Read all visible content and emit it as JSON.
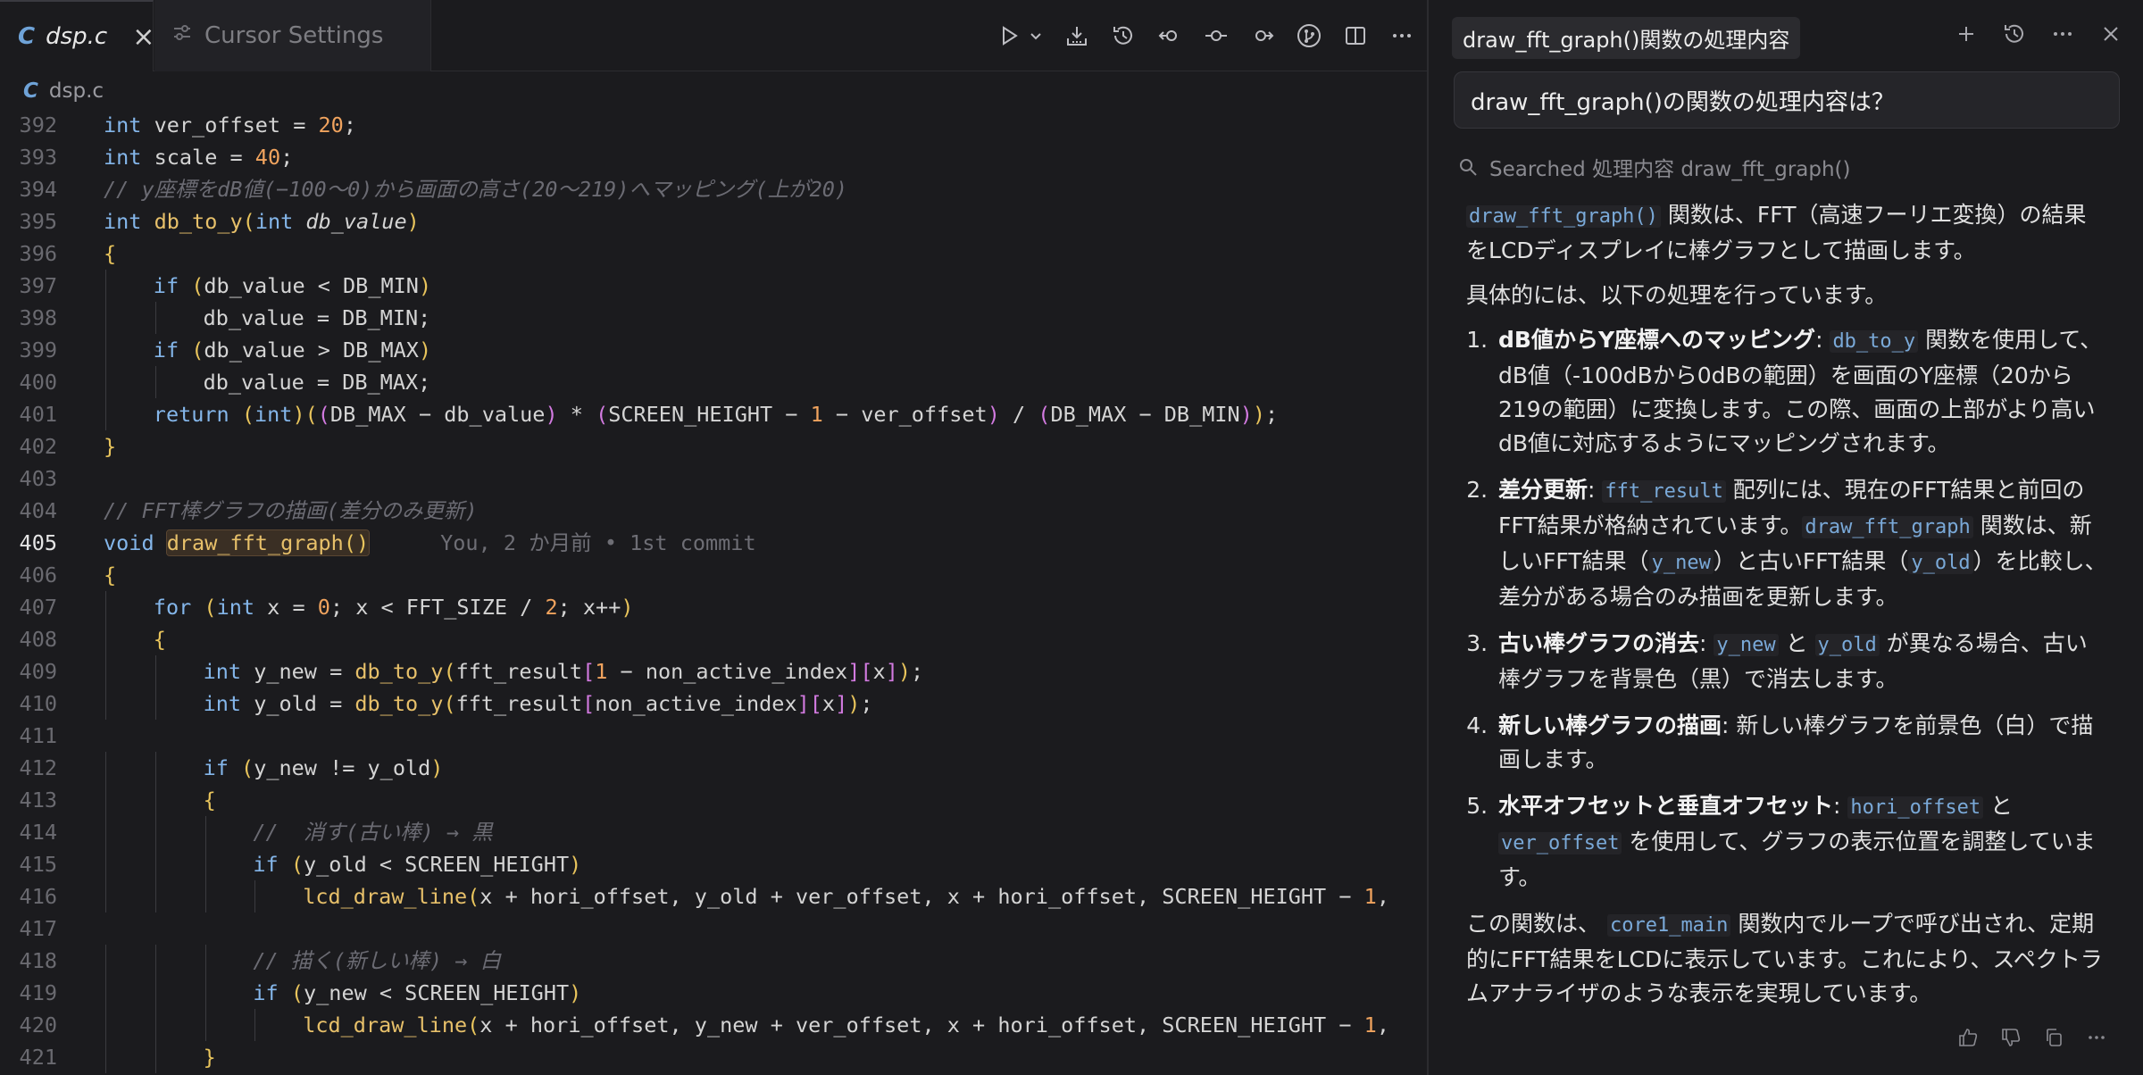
{
  "tabs": [
    {
      "icon": "c-file-icon",
      "glyph": "C",
      "label": "dsp.c",
      "active": true
    },
    {
      "icon": "settings-sliders-icon",
      "label": "Cursor Settings",
      "active": false
    }
  ],
  "breadcrumb": {
    "glyph": "C",
    "label": "dsp.c"
  },
  "toolbar": {
    "icons": [
      "run-icon",
      "chevron-down-icon",
      "download-icon",
      "history-icon",
      "go-back-icon",
      "commit-icon",
      "go-forward-icon",
      "git-graph-icon",
      "split-editor-icon",
      "more-icon"
    ]
  },
  "code": {
    "active_line": 405,
    "blame": "You, 2 か月前 • 1st commit",
    "lines": [
      {
        "n": "392",
        "text": "int ver_offset = 20;"
      },
      {
        "n": "393",
        "text": "int scale = 40;"
      },
      {
        "n": "394",
        "text": "// y座標をdB値(−100〜0)から画面の高さ(20〜219)へマッピング(上が20)"
      },
      {
        "n": "395",
        "text": "int db_to_y(int db_value)"
      },
      {
        "n": "396",
        "text": "{"
      },
      {
        "n": "397",
        "text": "if (db_value < DB_MIN)"
      },
      {
        "n": "398",
        "text": "db_value = DB_MIN;"
      },
      {
        "n": "399",
        "text": "if (db_value > DB_MAX)"
      },
      {
        "n": "400",
        "text": "db_value = DB_MAX;"
      },
      {
        "n": "401",
        "text": "return (int)((DB_MAX − db_value) * (SCREEN_HEIGHT − 1 − ver_offset) / (DB_MAX − DB_MIN));"
      },
      {
        "n": "402",
        "text": "}"
      },
      {
        "n": "403",
        "text": ""
      },
      {
        "n": "404",
        "text": "// FFT棒グラフの描画(差分のみ更新)"
      },
      {
        "n": "405",
        "text": "void draw_fft_graph()"
      },
      {
        "n": "406",
        "text": "{"
      },
      {
        "n": "407",
        "text": "for (int x = 0; x < FFT_SIZE / 2; x++)"
      },
      {
        "n": "408",
        "text": "{"
      },
      {
        "n": "409",
        "text": "int y_new = db_to_y(fft_result[1 − non_active_index][x]);"
      },
      {
        "n": "410",
        "text": "int y_old = db_to_y(fft_result[non_active_index][x]);"
      },
      {
        "n": "411",
        "text": ""
      },
      {
        "n": "412",
        "text": "if (y_new != y_old)"
      },
      {
        "n": "413",
        "text": "{"
      },
      {
        "n": "414",
        "text": "//  消す(古い棒) → 黒"
      },
      {
        "n": "415",
        "text": "if (y_old < SCREEN_HEIGHT)"
      },
      {
        "n": "416",
        "text": "lcd_draw_line(x + hori_offset, y_old + ver_offset, x + hori_offset, SCREEN_HEIGHT − 1,"
      },
      {
        "n": "417",
        "text": ""
      },
      {
        "n": "418",
        "text": "// 描く(新しい棒) → 白"
      },
      {
        "n": "419",
        "text": "if (y_new < SCREEN_HEIGHT)"
      },
      {
        "n": "420",
        "text": "lcd_draw_line(x + hori_offset, y_new + ver_offset, x + hori_offset, SCREEN_HEIGHT − 1,"
      },
      {
        "n": "421",
        "text": "}"
      }
    ]
  },
  "chat": {
    "title": "draw_fft_graph()関数の処理内容",
    "actions": [
      "plus-icon",
      "history-icon",
      "more-icon",
      "close-icon"
    ],
    "user_message": "draw_fft_graph()の関数の処理内容は？",
    "search_status": "Searched 処理内容 draw_fft_graph()",
    "answer": {
      "intro_code": "draw_fft_graph()",
      "intro_text": "関数は、FFT（高速フーリエ変換）の結果をLCDディスプレイに棒グラフとして描画します。",
      "lead": "具体的には、以下の処理を行っています。",
      "items": [
        {
          "title": "dB値からY座標へのマッピング",
          "c1": "db_to_y",
          "t1": "関数を使用して、dB値（-100dBから0dBの範囲）を画面のY座標（20から219の範囲）に変換します。この際、画面の上部がより高いdB値に対応するようにマッピングされます。"
        },
        {
          "title": "差分更新",
          "c1": "fft_result",
          "t1": "配列には、現在のFFT結果と前回のFFT結果が格納されています。",
          "c2": "draw_fft_graph",
          "t2": "関数は、新しいFFT結果（",
          "c3": "y_new",
          "t3": "）と古いFFT結果（",
          "c4": "y_old",
          "t4": "）を比較し、差分がある場合のみ描画を更新します。"
        },
        {
          "title": "古い棒グラフの消去",
          "c1": "y_new",
          "t1": "と",
          "c2": "y_old",
          "t2": "が異なる場合、古い棒グラフを背景色（黒）で消去します。"
        },
        {
          "title": "新しい棒グラフの描画",
          "t1": "新しい棒グラフを前景色（白）で描画します。"
        },
        {
          "title": "水平オフセットと垂直オフセット",
          "c1": "hori_offset",
          "t1": "と",
          "c2": "ver_offset",
          "t2": "を使用して、グラフの表示位置を調整しています。"
        }
      ],
      "outro_pre": "この関数は、",
      "outro_code": "core1_main",
      "outro_text": "関数内でループで呼び出され、定期的にFFT結果をLCDに表示しています。これにより、スペクトラムアナライザのような表示を実現しています。"
    },
    "feedback": [
      "thumbs-up-icon",
      "thumbs-down-icon",
      "copy-icon",
      "more-icon"
    ]
  }
}
